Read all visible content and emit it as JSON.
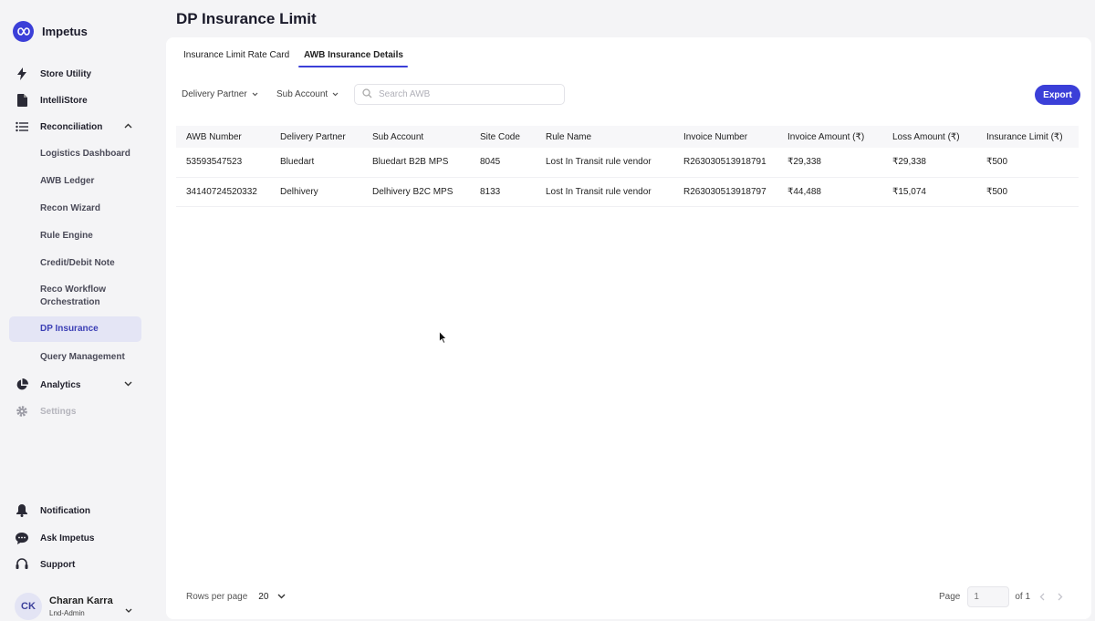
{
  "app": {
    "name": "Impetus"
  },
  "sidebar": {
    "items": [
      {
        "label": "Store Utility",
        "icon": "bolt-icon"
      },
      {
        "label": "IntelliStore",
        "icon": "file-icon"
      },
      {
        "label": "Reconciliation",
        "icon": "list-icon",
        "expanded": true
      },
      {
        "label": "Analytics",
        "icon": "pie-chart-icon",
        "expanded": false
      },
      {
        "label": "Settings",
        "icon": "gear-icon",
        "disabled": true
      }
    ],
    "sub_items": [
      {
        "label": "Logistics Dashboard"
      },
      {
        "label": "AWB Ledger"
      },
      {
        "label": "Recon Wizard"
      },
      {
        "label": "Rule Engine"
      },
      {
        "label": "Credit/Debit Note"
      },
      {
        "label": "Reco Workflow Orchestration"
      },
      {
        "label": "DP Insurance",
        "active": true
      },
      {
        "label": "Query Management"
      }
    ],
    "bottom": [
      {
        "label": "Notification",
        "icon": "bell-icon"
      },
      {
        "label": "Ask Impetus",
        "icon": "chat-icon"
      },
      {
        "label": "Support",
        "icon": "headset-icon"
      }
    ],
    "user": {
      "initials": "CK",
      "name": "Charan Karra",
      "role": "Lnd-Admin"
    }
  },
  "main": {
    "title": "DP Insurance Limit",
    "tabs": [
      {
        "label": "Insurance Limit Rate Card"
      },
      {
        "label": "AWB Insurance Details",
        "active": true
      }
    ],
    "filters": {
      "delivery_partner": "Delivery Partner",
      "sub_account": "Sub Account",
      "search_placeholder": "Search AWB"
    },
    "export_label": "Export",
    "table": {
      "columns": [
        "AWB Number",
        "Delivery Partner",
        "Sub Account",
        "Site Code",
        "Rule Name",
        "Invoice Number",
        "Invoice Amount (₹)",
        "Loss Amount (₹)",
        "Insurance Limit (₹)"
      ],
      "rows": [
        [
          "53593547523",
          "Bluedart",
          "Bluedart B2B MPS",
          "8045",
          "Lost In Transit rule vendor",
          "R263030513918791",
          "₹29,338",
          "₹29,338",
          "₹500"
        ],
        [
          "34140724520332",
          "Delhivery",
          "Delhivery B2C MPS",
          "8133",
          "Lost In Transit rule vendor",
          "R263030513918797",
          "₹44,488",
          "₹15,074",
          "₹500"
        ]
      ]
    },
    "pagination": {
      "rows_per_page_label": "Rows per page",
      "rows_per_page": "20",
      "page_label": "Page",
      "page_input_placeholder": "1",
      "of_label": "of 1"
    }
  },
  "colors": {
    "accent": "#3b3fd8",
    "active_bg": "#e4e5f5"
  }
}
